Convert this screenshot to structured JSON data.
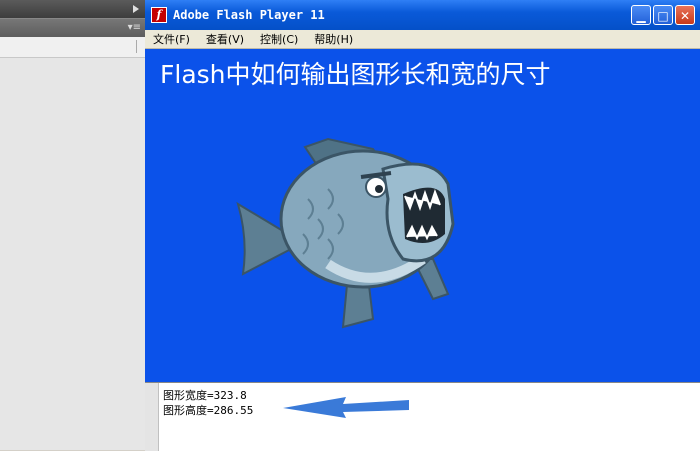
{
  "window": {
    "title": "Adobe Flash Player 11",
    "icon": "flash-player-icon",
    "icon_glyph": "f",
    "controls": {
      "minimize": "minimize-icon",
      "maximize": "maximize-icon",
      "close": "close-icon"
    }
  },
  "menu": [
    {
      "label": "文件(F)"
    },
    {
      "label": "查看(V)"
    },
    {
      "label": "控制(C)"
    },
    {
      "label": "帮助(H)"
    }
  ],
  "stage": {
    "title": "Flash中如何输出图形长和宽的尺寸",
    "background": "#0b52ea",
    "graphic": "piranha-fish"
  },
  "output": {
    "lines": [
      "图形宽度=323.8",
      "图形高度=286.55"
    ]
  },
  "colors": {
    "arrow": "#3a7ad8",
    "title_bar": "#0a5ad9"
  }
}
